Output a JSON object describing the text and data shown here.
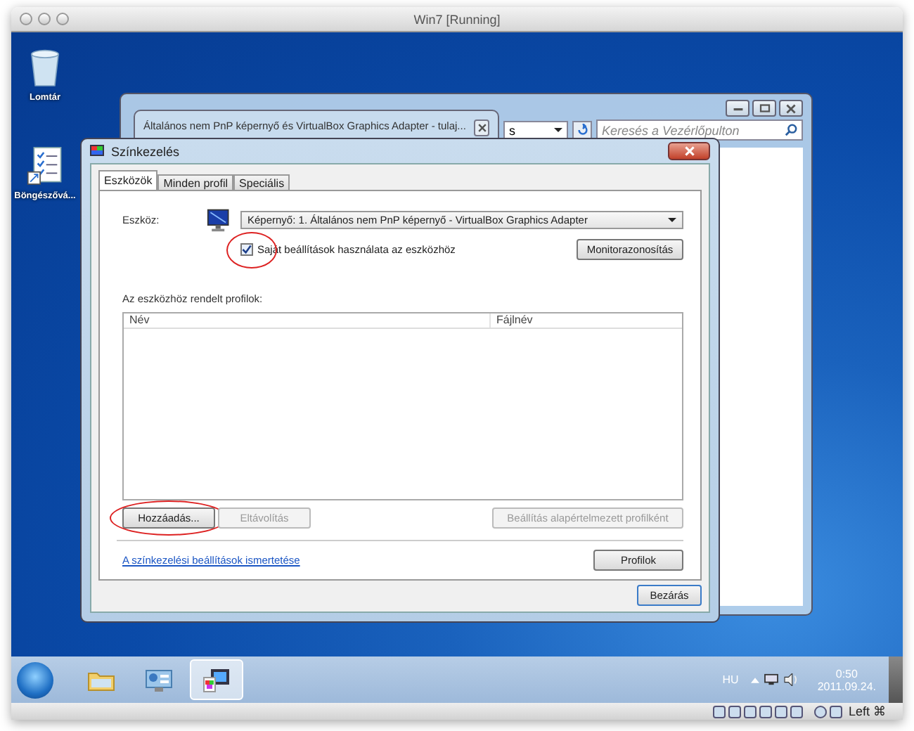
{
  "window": {
    "title": "Win7 [Running]"
  },
  "desktop_icons": [
    {
      "kind": "bin",
      "label": "Lomtár"
    },
    {
      "kind": "list",
      "label": "Böngészővá..."
    }
  ],
  "background_window": {
    "address_text": "s",
    "search": {
      "placeholder": "Keresés a Vezérlőpulton"
    }
  },
  "properties_window": {
    "title": "Általános nem PnP képernyő és VirtualBox Graphics Adapter - tulaj..."
  },
  "dialog": {
    "title": "Színkezelés",
    "tabs": [
      {
        "label": "Eszközök",
        "selected": true
      },
      {
        "label": "Minden profil",
        "selected": false
      },
      {
        "label": "Speciális",
        "selected": false
      }
    ],
    "device_label": "Eszköz:",
    "device_value": "Képernyő: 1. Általános nem PnP képernyő - VirtualBox Graphics Adapter",
    "own_settings": {
      "label": "Saját beállítások használata az eszközhöz",
      "checked": true
    },
    "identify_button": "Monitorazonosítás",
    "profiles_label": "Az eszközhöz rendelt profilok:",
    "columns": [
      "Név",
      "Fájlnév"
    ],
    "buttons": [
      {
        "label": "Hozzáadás...",
        "disabled": false
      },
      {
        "label": "Eltávolítás",
        "disabled": true
      },
      {
        "label": "Beállítás alapértelmezett profilként",
        "disabled": true
      }
    ],
    "link": "A színkezelési beállítások ismertetése",
    "profiles_button": "Profilok",
    "close_button": "Bezárás"
  },
  "taskbar": {
    "items": [
      {
        "kind": "folder",
        "selected": false
      },
      {
        "kind": "panel",
        "selected": false
      },
      {
        "kind": "color",
        "selected": true
      }
    ],
    "language": "HU",
    "time": "0:50",
    "date": "2011.09.24."
  },
  "vbox_status": {
    "host_key": "Left ⌘"
  }
}
